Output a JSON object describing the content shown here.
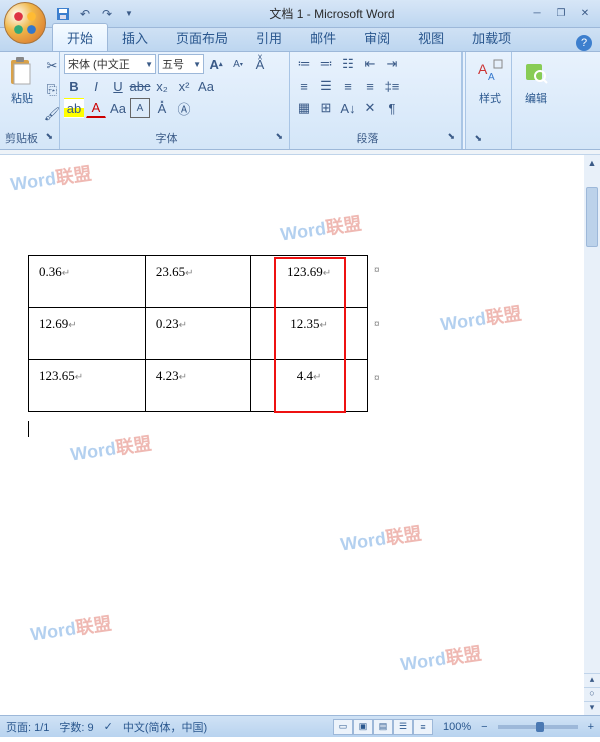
{
  "title": "文档 1 - Microsoft Word",
  "tabs": [
    "开始",
    "插入",
    "页面布局",
    "引用",
    "邮件",
    "审阅",
    "视图",
    "加载项"
  ],
  "active_tab": 0,
  "ribbon": {
    "clipboard": {
      "label": "剪贴板",
      "paste": "粘贴"
    },
    "font": {
      "label": "字体",
      "name": "宋体 (中文正",
      "size": "五号"
    },
    "paragraph": {
      "label": "段落"
    },
    "styles": {
      "label": "样式"
    },
    "editing": {
      "label": "编辑"
    }
  },
  "table": {
    "rows": [
      [
        "0.36",
        "23.65",
        "123.69"
      ],
      [
        "12.69",
        "0.23",
        "12.35"
      ],
      [
        "123.65",
        "4.23",
        "4.4"
      ]
    ]
  },
  "status": {
    "page": "页面: 1/1",
    "words": "字数: 9",
    "lang": "中文(简体，中国)",
    "zoom": "100%"
  },
  "watermark": {
    "text_blue": "Word",
    "text_red": "联盟"
  }
}
